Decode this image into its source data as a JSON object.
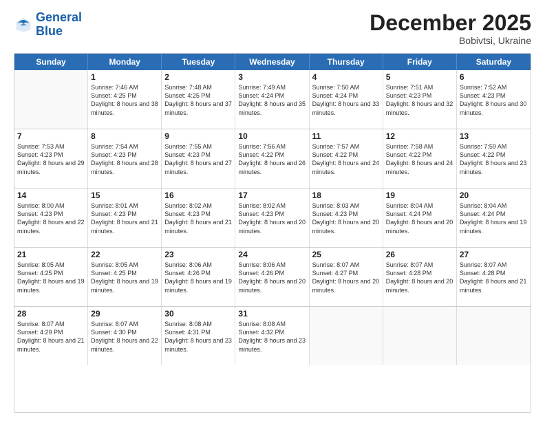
{
  "header": {
    "logo_general": "General",
    "logo_blue": "Blue",
    "main_title": "December 2025",
    "subtitle": "Bobivtsi, Ukraine"
  },
  "days_of_week": [
    "Sunday",
    "Monday",
    "Tuesday",
    "Wednesday",
    "Thursday",
    "Friday",
    "Saturday"
  ],
  "weeks": [
    [
      {
        "day": "",
        "empty": true
      },
      {
        "day": "1",
        "sunrise": "7:46 AM",
        "sunset": "4:25 PM",
        "daylight": "8 hours and 38 minutes."
      },
      {
        "day": "2",
        "sunrise": "7:48 AM",
        "sunset": "4:25 PM",
        "daylight": "8 hours and 37 minutes."
      },
      {
        "day": "3",
        "sunrise": "7:49 AM",
        "sunset": "4:24 PM",
        "daylight": "8 hours and 35 minutes."
      },
      {
        "day": "4",
        "sunrise": "7:50 AM",
        "sunset": "4:24 PM",
        "daylight": "8 hours and 33 minutes."
      },
      {
        "day": "5",
        "sunrise": "7:51 AM",
        "sunset": "4:23 PM",
        "daylight": "8 hours and 32 minutes."
      },
      {
        "day": "6",
        "sunrise": "7:52 AM",
        "sunset": "4:23 PM",
        "daylight": "8 hours and 30 minutes."
      }
    ],
    [
      {
        "day": "7",
        "sunrise": "7:53 AM",
        "sunset": "4:23 PM",
        "daylight": "8 hours and 29 minutes."
      },
      {
        "day": "8",
        "sunrise": "7:54 AM",
        "sunset": "4:23 PM",
        "daylight": "8 hours and 28 minutes."
      },
      {
        "day": "9",
        "sunrise": "7:55 AM",
        "sunset": "4:23 PM",
        "daylight": "8 hours and 27 minutes."
      },
      {
        "day": "10",
        "sunrise": "7:56 AM",
        "sunset": "4:22 PM",
        "daylight": "8 hours and 26 minutes."
      },
      {
        "day": "11",
        "sunrise": "7:57 AM",
        "sunset": "4:22 PM",
        "daylight": "8 hours and 24 minutes."
      },
      {
        "day": "12",
        "sunrise": "7:58 AM",
        "sunset": "4:22 PM",
        "daylight": "8 hours and 24 minutes."
      },
      {
        "day": "13",
        "sunrise": "7:59 AM",
        "sunset": "4:22 PM",
        "daylight": "8 hours and 23 minutes."
      }
    ],
    [
      {
        "day": "14",
        "sunrise": "8:00 AM",
        "sunset": "4:23 PM",
        "daylight": "8 hours and 22 minutes."
      },
      {
        "day": "15",
        "sunrise": "8:01 AM",
        "sunset": "4:23 PM",
        "daylight": "8 hours and 21 minutes."
      },
      {
        "day": "16",
        "sunrise": "8:02 AM",
        "sunset": "4:23 PM",
        "daylight": "8 hours and 21 minutes."
      },
      {
        "day": "17",
        "sunrise": "8:02 AM",
        "sunset": "4:23 PM",
        "daylight": "8 hours and 20 minutes."
      },
      {
        "day": "18",
        "sunrise": "8:03 AM",
        "sunset": "4:23 PM",
        "daylight": "8 hours and 20 minutes."
      },
      {
        "day": "19",
        "sunrise": "8:04 AM",
        "sunset": "4:24 PM",
        "daylight": "8 hours and 20 minutes."
      },
      {
        "day": "20",
        "sunrise": "8:04 AM",
        "sunset": "4:24 PM",
        "daylight": "8 hours and 19 minutes."
      }
    ],
    [
      {
        "day": "21",
        "sunrise": "8:05 AM",
        "sunset": "4:25 PM",
        "daylight": "8 hours and 19 minutes."
      },
      {
        "day": "22",
        "sunrise": "8:05 AM",
        "sunset": "4:25 PM",
        "daylight": "8 hours and 19 minutes."
      },
      {
        "day": "23",
        "sunrise": "8:06 AM",
        "sunset": "4:26 PM",
        "daylight": "8 hours and 19 minutes."
      },
      {
        "day": "24",
        "sunrise": "8:06 AM",
        "sunset": "4:26 PM",
        "daylight": "8 hours and 20 minutes."
      },
      {
        "day": "25",
        "sunrise": "8:07 AM",
        "sunset": "4:27 PM",
        "daylight": "8 hours and 20 minutes."
      },
      {
        "day": "26",
        "sunrise": "8:07 AM",
        "sunset": "4:28 PM",
        "daylight": "8 hours and 20 minutes."
      },
      {
        "day": "27",
        "sunrise": "8:07 AM",
        "sunset": "4:28 PM",
        "daylight": "8 hours and 21 minutes."
      }
    ],
    [
      {
        "day": "28",
        "sunrise": "8:07 AM",
        "sunset": "4:29 PM",
        "daylight": "8 hours and 21 minutes."
      },
      {
        "day": "29",
        "sunrise": "8:07 AM",
        "sunset": "4:30 PM",
        "daylight": "8 hours and 22 minutes."
      },
      {
        "day": "30",
        "sunrise": "8:08 AM",
        "sunset": "4:31 PM",
        "daylight": "8 hours and 23 minutes."
      },
      {
        "day": "31",
        "sunrise": "8:08 AM",
        "sunset": "4:32 PM",
        "daylight": "8 hours and 23 minutes."
      },
      {
        "day": "",
        "empty": true
      },
      {
        "day": "",
        "empty": true
      },
      {
        "day": "",
        "empty": true
      }
    ]
  ],
  "labels": {
    "sunrise": "Sunrise:",
    "sunset": "Sunset:",
    "daylight": "Daylight:"
  }
}
